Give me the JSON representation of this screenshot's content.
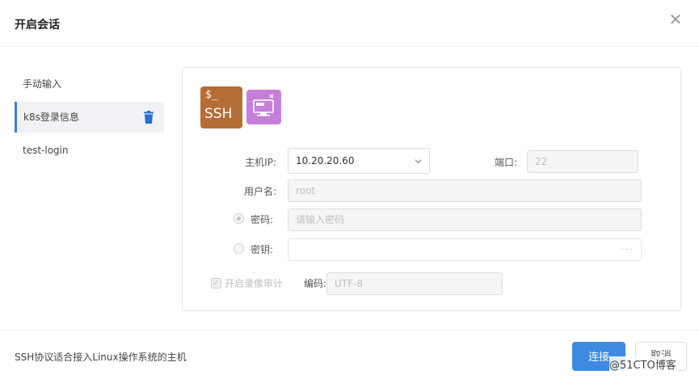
{
  "dialog": {
    "title": "开启会话"
  },
  "sidebar": {
    "items": [
      {
        "label": "手动输入"
      },
      {
        "label": "k8s登录信息",
        "active": true
      },
      {
        "label": "test-login"
      }
    ]
  },
  "protocols": {
    "ssh": {
      "prompt": "$_",
      "name": "SSH"
    },
    "rdp": {
      "icon": "rdp-monitor-icon"
    }
  },
  "form": {
    "host_label": "主机IP:",
    "host_value": "10.20.20.60",
    "port_label": "端口:",
    "port_value": "22",
    "username_label": "用户名:",
    "username_value": "root",
    "password_label": "密码:",
    "password_placeholder": "请输入密码",
    "key_label": "密钥:",
    "key_dots": "···",
    "recording_label": "开启录像审计",
    "encoding_label": "编码:",
    "encoding_value": "UTF-8"
  },
  "footer": {
    "note": "SSH协议适合接入Linux操作系统的主机",
    "connect_label": "连接",
    "cancel_label": "取消"
  },
  "watermark": "@51CTO博客",
  "colors": {
    "accent": "#3d8ae0",
    "ssh_tile": "#b66d35",
    "rdp_tile": "#c67fd9",
    "trash_icon": "#2b6fcf"
  }
}
